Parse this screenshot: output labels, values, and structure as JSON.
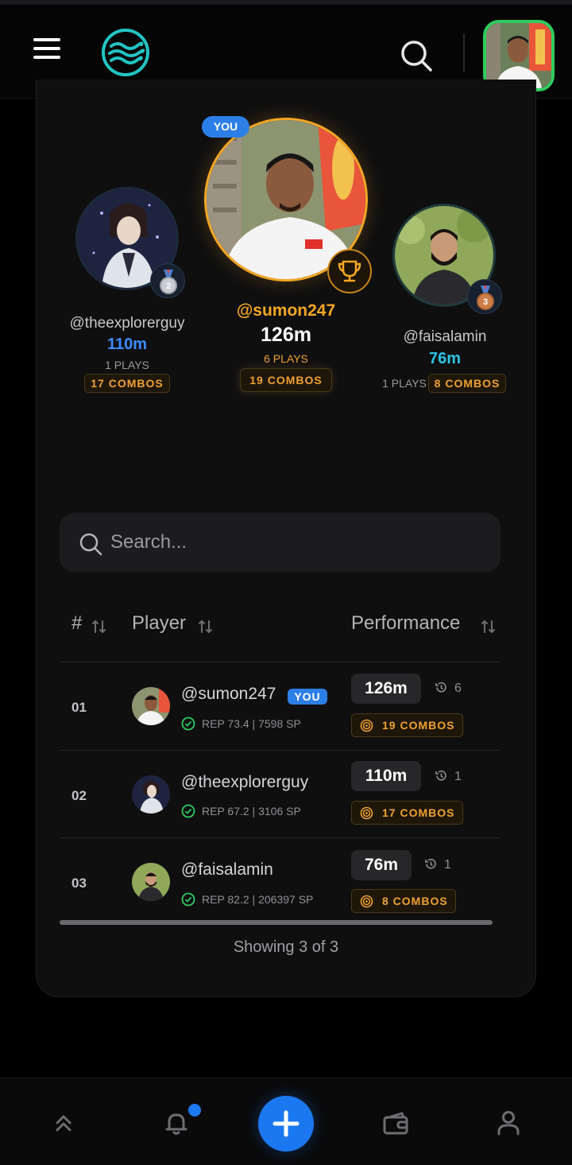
{
  "header": {
    "menu_icon": "hamburger-menu-icon",
    "logo_icon": "waves-logo-icon",
    "search_icon": "search-icon"
  },
  "podium": {
    "you_label": "YOU",
    "first": {
      "username": "@sumon247",
      "distance": "126m",
      "plays": "6 PLAYS",
      "combos": "19 COMBOS",
      "badge_icon": "trophy-icon"
    },
    "second": {
      "username": "@theexplorerguy",
      "distance": "110m",
      "plays": "1 PLAYS",
      "combos": "17 COMBOS",
      "badge_icon": "medal-2-icon"
    },
    "third": {
      "username": "@faisalamin",
      "distance": "76m",
      "plays": "1 PLAYS",
      "combos": "8 COMBOS",
      "badge_icon": "medal-3-icon"
    }
  },
  "search": {
    "placeholder": "Search..."
  },
  "table": {
    "headers": {
      "rank": "#",
      "player": "Player",
      "performance": "Performance"
    },
    "rows": [
      {
        "rank": "01",
        "username": "@sumon247",
        "you": "YOU",
        "rep": "REP 73.4 | 7598 SP",
        "distance": "126m",
        "plays": "6",
        "combos": "19 COMBOS"
      },
      {
        "rank": "02",
        "username": "@theexplorerguy",
        "rep": "REP 67.2 | 3106 SP",
        "distance": "110m",
        "plays": "1",
        "combos": "17 COMBOS"
      },
      {
        "rank": "03",
        "username": "@faisalamin",
        "rep": "REP 82.2 | 206397 SP",
        "distance": "76m",
        "plays": "1",
        "combos": "8 COMBOS"
      }
    ],
    "footer": "Showing 3 of 3"
  },
  "colors": {
    "accent_blue": "#2d7fe8",
    "gold": "#f0a030",
    "first_place": "#f5a623",
    "distance_blue": "#3d8bff",
    "distance_cyan": "#2ec4e6",
    "online_green": "#2ecc5e"
  },
  "bottom_nav": [
    "chevrons-up-icon",
    "bell-icon",
    "plus-icon",
    "wallet-icon",
    "user-icon"
  ]
}
